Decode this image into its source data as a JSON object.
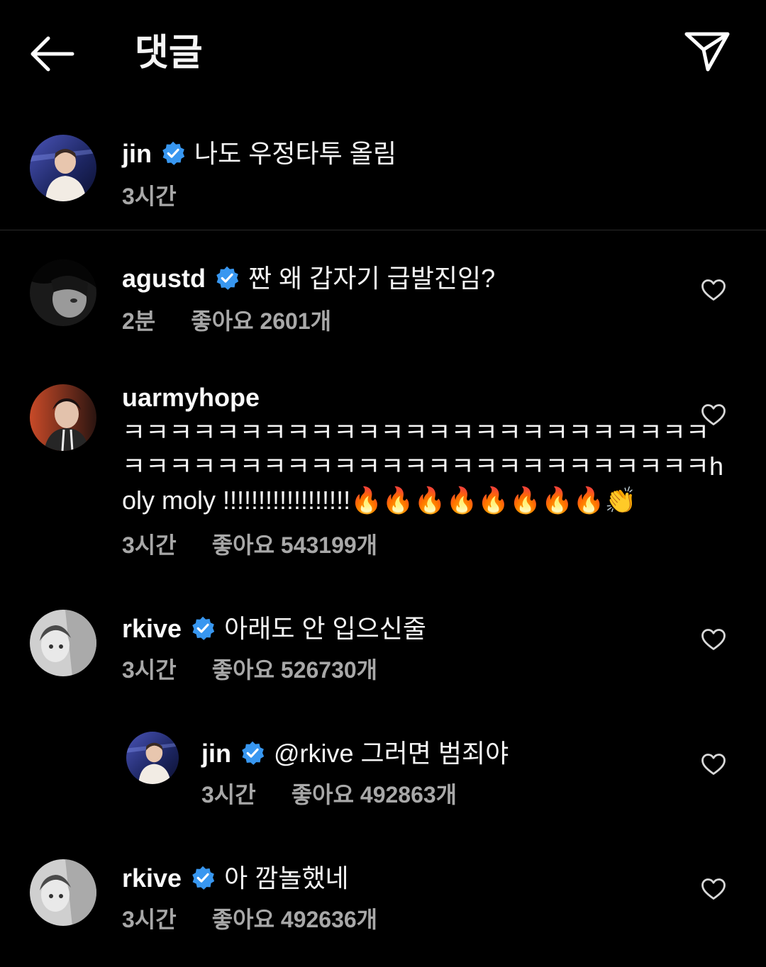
{
  "header": {
    "title": "댓글"
  },
  "caption": {
    "username": "jin",
    "text": "나도 우정타투 올림",
    "time": "3시간"
  },
  "comments": [
    {
      "username": "agustd",
      "text": "짠 왜 갑자기 급발진임?",
      "time": "2분",
      "likes": "좋아요 2601개"
    },
    {
      "username": "uarmyhope",
      "text_lines": [
        "ㅋㅋㅋㅋㅋㅋㅋㅋㅋㅋㅋㅋㅋㅋㅋㅋㅋㅋㅋㅋㅋㅋㅋㅋㅋ",
        "ㅋㅋㅋㅋㅋㅋㅋㅋㅋㅋㅋㅋㅋㅋㅋㅋㅋㅋㅋㅋㅋㅋㅋㅋㅋh",
        "oly moly !!!!!!!!!!!!!!!!!!🔥🔥🔥🔥🔥🔥🔥🔥👏"
      ],
      "time": "3시간",
      "likes": "좋아요 543199개"
    },
    {
      "username": "rkive",
      "text": "아래도 안 입으신줄",
      "time": "3시간",
      "likes": "좋아요 526730개"
    },
    {
      "username": "jin",
      "text": "@rkive 그러면 범죄야",
      "time": "3시간",
      "likes": "좋아요 492863개"
    },
    {
      "username": "rkive",
      "text": "아 깜놀했네",
      "time": "3시간",
      "likes": "좋아요 492636개"
    }
  ],
  "colors": {
    "background": "#000000",
    "verified": "#3897f0",
    "meta": "#a8a8a8"
  }
}
